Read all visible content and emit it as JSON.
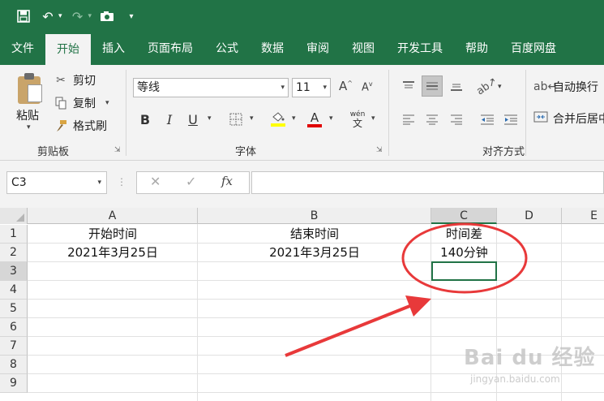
{
  "qat": {
    "icons": [
      "save-icon",
      "undo-icon",
      "redo-icon",
      "camera-icon",
      "customize-icon"
    ]
  },
  "tabs": [
    "文件",
    "开始",
    "插入",
    "页面布局",
    "公式",
    "数据",
    "审阅",
    "视图",
    "开发工具",
    "帮助",
    "百度网盘"
  ],
  "active_tab": "开始",
  "ribbon": {
    "clipboard": {
      "paste": "粘贴",
      "cut": "剪切",
      "copy": "复制",
      "format_painter": "格式刷",
      "label": "剪贴板"
    },
    "font": {
      "font_name": "等线",
      "font_size": "11",
      "grow": "A",
      "shrink": "A",
      "bold": "B",
      "italic": "I",
      "underline": "U",
      "font_color_label": "A",
      "phonetic": "wén",
      "phonetic_char": "文",
      "label": "字体"
    },
    "alignment": {
      "wrap_text": "自动换行",
      "merge_center": "合并后居中",
      "label": "对齐方式"
    }
  },
  "formula_bar": {
    "name_box": "C3",
    "formula": ""
  },
  "sheet": {
    "columns": [
      "A",
      "B",
      "C",
      "D",
      "E"
    ],
    "rows": [
      "1",
      "2",
      "3",
      "4",
      "5",
      "6",
      "7",
      "8",
      "9"
    ],
    "cells": {
      "A1": "开始时间",
      "B1": "结束时间",
      "C1": "时间差",
      "A2": "2021年3月25日",
      "B2": "2021年3月25日",
      "C2": "140分钟"
    }
  },
  "watermark": {
    "logo": "Bai du 经验",
    "url": "jingyan.baidu.com"
  },
  "colors": {
    "brand": "#217346",
    "annotation": "#e8393a"
  }
}
